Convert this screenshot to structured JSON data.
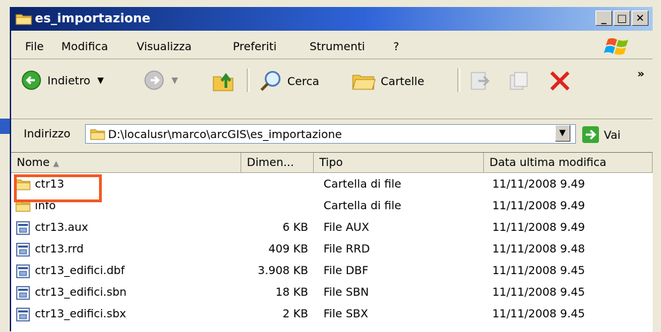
{
  "window": {
    "title": "es_importazione",
    "controls": [
      "_",
      "□",
      "✕"
    ]
  },
  "menu": [
    "File",
    "Modifica",
    "Visualizza",
    "Preferiti",
    "Strumenti",
    "?"
  ],
  "toolbar": {
    "back_label": "Indietro",
    "search_label": "Cerca",
    "folders_label": "Cartelle",
    "overflow": "»"
  },
  "address": {
    "label": "Indirizzo",
    "path": "D:\\localusr\\marco\\arcGIS\\es_importazione",
    "go_label": "Vai"
  },
  "columns": [
    "Nome",
    "Dimen...",
    "Tipo",
    "Data ultima modifica"
  ],
  "files": [
    {
      "name": "ctr13",
      "size": "",
      "type": "Cartella di file",
      "date": "11/11/2008 9.49",
      "icon": "folder-icon"
    },
    {
      "name": "info",
      "size": "",
      "type": "Cartella di file",
      "date": "11/11/2008 9.49",
      "icon": "folder-icon"
    },
    {
      "name": "ctr13.aux",
      "size": "6 KB",
      "type": "File AUX",
      "date": "11/11/2008 9.49",
      "icon": "file-icon"
    },
    {
      "name": "ctr13.rrd",
      "size": "409 KB",
      "type": "File RRD",
      "date": "11/11/2008 9.48",
      "icon": "file-icon"
    },
    {
      "name": "ctr13_edifici.dbf",
      "size": "3.908 KB",
      "type": "File DBF",
      "date": "11/11/2008 9.45",
      "icon": "file-icon"
    },
    {
      "name": "ctr13_edifici.sbn",
      "size": "18 KB",
      "type": "File SBN",
      "date": "11/11/2008 9.45",
      "icon": "file-icon"
    },
    {
      "name": "ctr13_edifici.sbx",
      "size": "2 KB",
      "type": "File SBX",
      "date": "11/11/2008 9.45",
      "icon": "file-icon"
    }
  ],
  "colors": {
    "highlight": "#f15a24",
    "title_bar": "#0a246a",
    "folder": "#f4c542"
  }
}
